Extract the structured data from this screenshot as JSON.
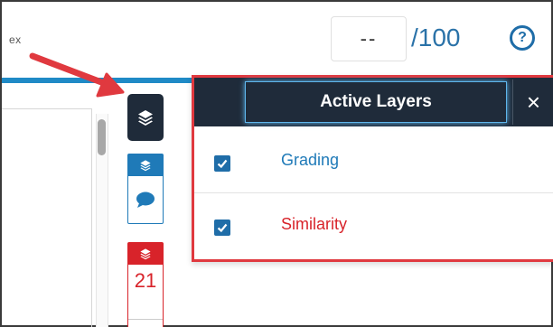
{
  "header": {
    "assignment_fragment": "ex",
    "score_value": "--",
    "score_total": "/100",
    "help_label": "?"
  },
  "layers_rail": {
    "toggle_icon": "layers-icon",
    "grading_icon": "comment-icon",
    "similarity_count": "21"
  },
  "active_layers_panel": {
    "title": "Active Layers",
    "close_label": "×",
    "layers": [
      {
        "label": "Grading",
        "checked": true,
        "color": "#1f7ab8"
      },
      {
        "label": "Similarity",
        "checked": true,
        "color": "#d8232a"
      }
    ]
  },
  "colors": {
    "accent_blue": "#1f7ab8",
    "accent_red": "#d8232a",
    "header_dark": "#1f2b3a",
    "annotation_red": "#e0393f"
  }
}
